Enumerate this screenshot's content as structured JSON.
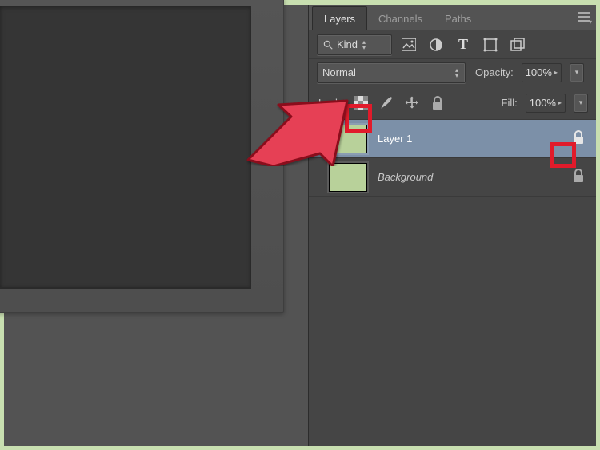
{
  "tabs": {
    "layers": "Layers",
    "channels": "Channels",
    "paths": "Paths"
  },
  "filter": {
    "kind": "Kind"
  },
  "blend": {
    "mode": "Normal",
    "opacity_label": "Opacity:",
    "opacity_value": "100%"
  },
  "lock": {
    "label": "Lock:",
    "fill_label": "Fill:",
    "fill_value": "100%"
  },
  "layers": [
    {
      "name": "Layer 1",
      "selected": true,
      "locked": true
    },
    {
      "name": "Background",
      "selected": false,
      "locked": true,
      "bg": true
    }
  ]
}
